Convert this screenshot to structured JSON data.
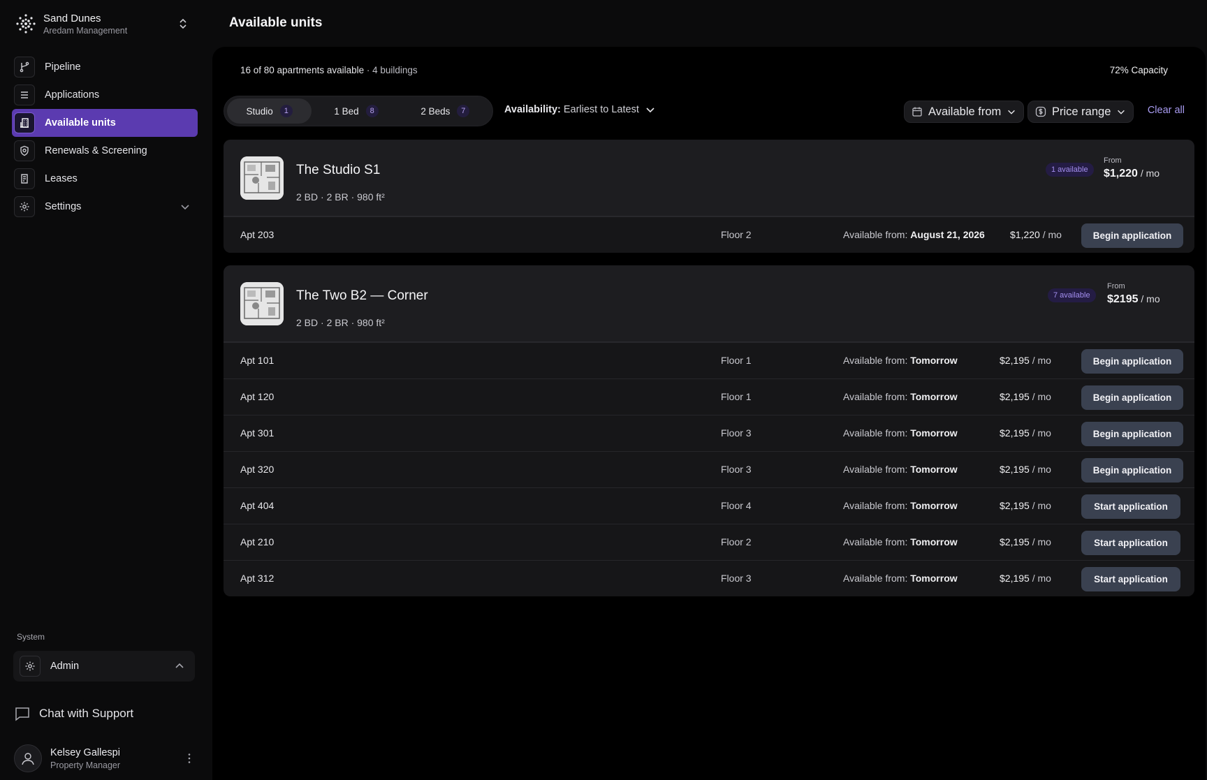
{
  "org": {
    "name": "Sand Dunes",
    "subtitle": "Aredam Management"
  },
  "nav": [
    {
      "label": "Pipeline",
      "icon": "branch-icon"
    },
    {
      "label": "Applications",
      "icon": "list-icon"
    },
    {
      "label": "Available units",
      "icon": "building-icon",
      "active": true
    },
    {
      "label": "Renewals & Screening",
      "icon": "badge-icon"
    },
    {
      "label": "Leases",
      "icon": "document-icon"
    },
    {
      "label": "Settings",
      "icon": "gear-icon"
    }
  ],
  "system": {
    "label": "System",
    "admin_label": "Admin"
  },
  "support": {
    "label": "Chat with Support"
  },
  "user": {
    "name": "Kelsey Gallespi",
    "role": "Property Manager"
  },
  "page": {
    "title": "Available units"
  },
  "summary": {
    "count_text": "16 of 80 apartments available",
    "buildings_text": "· 4 buildings",
    "capacity": "72% Capacity"
  },
  "tabs": [
    {
      "label": "Studio",
      "count": "1",
      "active": true
    },
    {
      "label": "1 Bed",
      "count": "8"
    },
    {
      "label": "2 Beds",
      "count": "7"
    }
  ],
  "sort": {
    "key": "Availability:",
    "value": "Earliest to Latest"
  },
  "filters": {
    "available_from": "Available from",
    "price_range": "Price range",
    "clear_all": "Clear all"
  },
  "groups": [
    {
      "title": "The Studio S1",
      "meta": "2 BD · 2 BR · 980 ft²",
      "badge": "1 available",
      "from_label": "From",
      "from_price": "$1,220",
      "from_unit": " / mo",
      "units": [
        {
          "apt": "Apt 203",
          "floor": "Floor 2",
          "avail_label": "Available from:",
          "avail_value": "August 21, 2026",
          "price": "$1,220",
          "unit": " / mo",
          "action": "Begin application"
        }
      ]
    },
    {
      "title": "The Two B2 — Corner",
      "meta": "2 BD · 2 BR · 980 ft²",
      "badge": "7 available",
      "from_label": "From",
      "from_price": "$2195",
      "from_unit": " / mo",
      "units": [
        {
          "apt": "Apt 101",
          "floor": "Floor 1",
          "avail_label": "Available from:",
          "avail_value": "Tomorrow",
          "price": "$2,195",
          "unit": " / mo",
          "action": "Begin application"
        },
        {
          "apt": "Apt 120",
          "floor": "Floor 1",
          "avail_label": "Available from:",
          "avail_value": "Tomorrow",
          "price": "$2,195",
          "unit": " / mo",
          "action": "Begin application"
        },
        {
          "apt": "Apt 301",
          "floor": "Floor 3",
          "avail_label": "Available from:",
          "avail_value": "Tomorrow",
          "price": "$2,195",
          "unit": " / mo",
          "action": "Begin application"
        },
        {
          "apt": "Apt 320",
          "floor": "Floor 3",
          "avail_label": "Available from:",
          "avail_value": "Tomorrow",
          "price": "$2,195",
          "unit": " / mo",
          "action": "Begin application"
        },
        {
          "apt": "Apt 404",
          "floor": "Floor 4",
          "avail_label": "Available from:",
          "avail_value": "Tomorrow",
          "price": "$2,195",
          "unit": " / mo",
          "action": "Start application"
        },
        {
          "apt": "Apt 210",
          "floor": "Floor 2",
          "avail_label": "Available from:",
          "avail_value": "Tomorrow",
          "price": "$2,195",
          "unit": " / mo",
          "action": "Start application"
        },
        {
          "apt": "Apt 312",
          "floor": "Floor 3",
          "avail_label": "Available from:",
          "avail_value": "Tomorrow",
          "price": "$2,195",
          "unit": " / mo",
          "action": "Start application"
        }
      ]
    }
  ]
}
